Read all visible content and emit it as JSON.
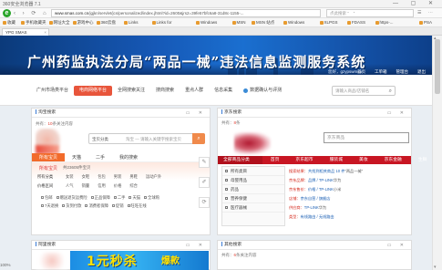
{
  "browser": {
    "window_title": "360安全浏览器 7.1",
    "url_host": "www.smas.com.cn",
    "url_path": "/jgjkn/servlet/jcs/personalized/index.jhtml?id=2600&jrs2=39fe57bfc6a8-31d8c-1155-...",
    "search_placeholder": "点此搜索 “    ”",
    "tab_label": "YPG SMAS",
    "favorites": [
      "收藏",
      "手机收藏夹",
      "网址大全",
      "游戏中心",
      "360云盘",
      "Links",
      "Links for",
      "Windows",
      "MSN",
      "MSN 站点",
      "Windows",
      "XLPGS",
      "FDASS",
      "https-...",
      "PSA"
    ]
  },
  "header": {
    "site_title": "广州药监执法分局“两品一械”违法信息监测服务系统",
    "user_label": "您好，gzypswmsa",
    "links": [
      "首页",
      "工单箱",
      "管理台",
      "退出"
    ]
  },
  "nav": {
    "items": [
      {
        "label": "广州市场类平台",
        "active": false
      },
      {
        "label": "电商网络平台",
        "active": true
      },
      {
        "label": "全网搜索关注",
        "active": false
      },
      {
        "label": "搜商搜索",
        "active": false
      },
      {
        "label": "重点人群",
        "active": false
      },
      {
        "label": "信息采集",
        "active": false
      },
      {
        "label": "数据确认与评测",
        "active": false
      }
    ],
    "search_placeholder": "请输入商品/店铺名"
  },
  "left_panel": {
    "title": "淘宝搜索",
    "hint_prefix": "共有：",
    "hint_count": "10",
    "hint_suffix": "条关注内容",
    "category_label": "宝贝分类",
    "search_placeholder": "淘宝 — 请输入关键字搜索宝贝",
    "tabs": [
      "所有宝贝",
      "天猫",
      "二手",
      "我的搜索"
    ],
    "hot_label": "所有宝贝",
    "hot_sub": "共23605件宝贝",
    "filter_rows": [
      {
        "key": "所有分类",
        "values": [
          "女装",
          "女鞋",
          "包包",
          "男装",
          "男鞋",
          "运动户外"
        ]
      },
      {
        "key": "价格区间",
        "values": [
          "人气",
          "销量",
          "信用",
          "价格",
          "综合"
        ]
      }
    ],
    "checkbox_rows": [
      [
        "包邮",
        "赠送退货运费险",
        "正品保障",
        "二手",
        "天猫",
        "全球购"
      ],
      [
        "7天退换",
        "货到付款",
        "消费者保障",
        "促销",
        "旺旺在线"
      ]
    ]
  },
  "right_panel": {
    "title": "京东搜索",
    "hint_prefix": "共有：",
    "hint_count": "8",
    "hint_suffix": "条",
    "search_placeholder": "京东商品",
    "categories": [
      "全部商品分类",
      "首页",
      "京东超市",
      "服装城",
      "美妆",
      "京东金融",
      "生鲜",
      "全球购"
    ],
    "list_items": [
      "所有类目",
      "母婴用品",
      "药品",
      "营养保健",
      "医疗器械"
    ],
    "info_lines": [
      {
        "a": "搜索结果：",
        "b": "共找到相关商品 10 件",
        "c": "“两品一械”"
      },
      {
        "a": "京东品牌：",
        "b": "品牌 / TP-LINK",
        "c": "华为"
      },
      {
        "a": "京东售价：",
        "b": "价格 / TP-LINK",
        "c": "小米"
      },
      {
        "a": "店铺：",
        "b": "京东自营 / 旗舰店",
        "c": ""
      },
      {
        "a": "供应商：",
        "b": "TP-LINK",
        "c": "华为"
      },
      {
        "a": "类型：",
        "b": "有线路由 / 无线路由",
        "c": ""
      }
    ]
  },
  "bottom_left": {
    "title": "阿里搜索",
    "ad_main": "1元秒杀",
    "ad_side": "爆款"
  },
  "bottom_right": {
    "title": "其他搜索",
    "hint_prefix": "共有：",
    "hint_count": "6",
    "hint_suffix": "条关注内容"
  },
  "status": {
    "left": "100%"
  },
  "colors": {
    "accent": "#e8553b",
    "banner": "#1658b6",
    "jd_red": "#c81623"
  }
}
